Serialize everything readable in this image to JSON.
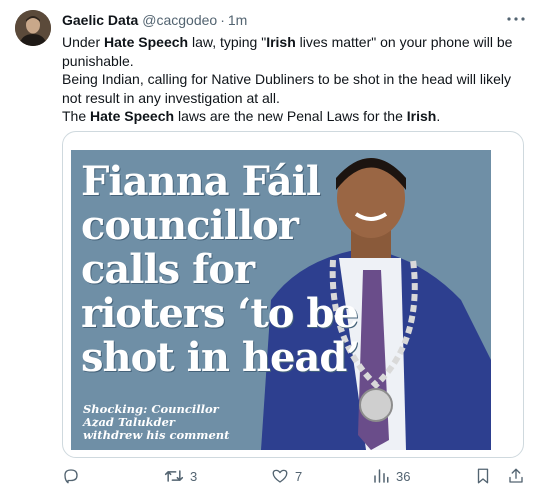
{
  "author": {
    "name": "Gaelic Data",
    "handle": "@cacgodeo",
    "separator": "·",
    "time": "1m"
  },
  "tweet": {
    "line1": {
      "a": "Under ",
      "b": "Hate Speech",
      "c": " law, typing \"",
      "d": "Irish",
      "e": " lives matter\" on your phone will be punishable."
    },
    "line2": "Being Indian, calling for Native Dubliners to be shot in the head will likely not result in any investigation at all.",
    "line3": {
      "a": "The ",
      "b": "Hate Speech",
      "c": " laws are the new Penal Laws for the ",
      "d": "Irish",
      "e": "."
    }
  },
  "media": {
    "headline_lines": [
      "Fianna Fáil",
      "councillor",
      "calls for",
      "rioters ‘to be",
      "shot in head’"
    ],
    "caption_lines": [
      "Shocking: Councillor",
      "Azad Talukder",
      "withdrew his comment"
    ],
    "background_color": "#6f8fa6"
  },
  "actions": {
    "reply": {
      "icon": "reply-icon",
      "count": ""
    },
    "retweet": {
      "icon": "retweet-icon",
      "count": "3"
    },
    "like": {
      "icon": "heart-icon",
      "count": "7"
    },
    "views": {
      "icon": "views-icon",
      "count": "36"
    },
    "bookmark": {
      "icon": "bookmark-icon"
    },
    "share": {
      "icon": "share-icon"
    }
  },
  "colors": {
    "text": "#0f1419",
    "secondary": "#536471",
    "border": "#cfd9de"
  }
}
